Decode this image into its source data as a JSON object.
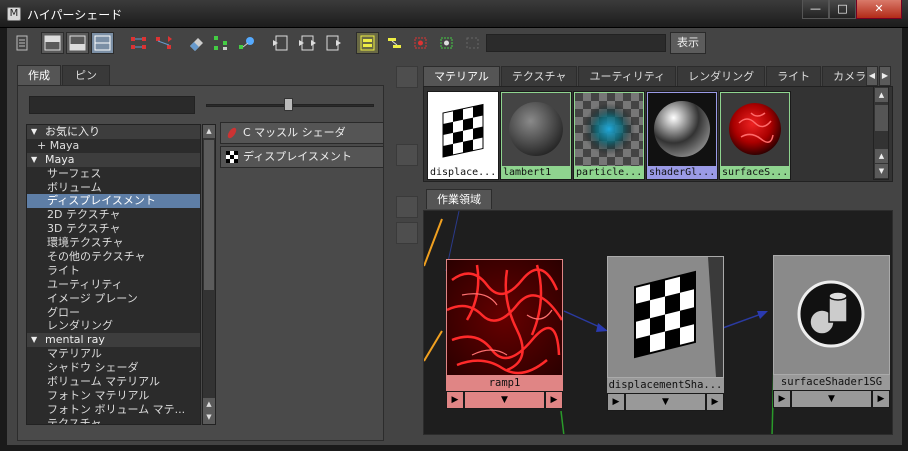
{
  "window": {
    "title": "ハイパーシェード",
    "minimize": "—",
    "maximize": "□",
    "close": "✕"
  },
  "toolbar": {
    "show_label": "表示",
    "search_value": ""
  },
  "left": {
    "tabs": [
      {
        "label": "作成"
      },
      {
        "label": "ピン"
      }
    ],
    "filter_value": "",
    "tree": [
      {
        "label": "お気に入り",
        "kind": "cat"
      },
      {
        "label": "+ Maya",
        "kind": "sub"
      },
      {
        "label": "Maya",
        "kind": "cat"
      },
      {
        "label": "サーフェス",
        "kind": "item"
      },
      {
        "label": "ボリューム",
        "kind": "item"
      },
      {
        "label": "ディスプレイスメント",
        "kind": "sel"
      },
      {
        "label": "2D テクスチャ",
        "kind": "item"
      },
      {
        "label": "3D テクスチャ",
        "kind": "item"
      },
      {
        "label": "環境テクスチャ",
        "kind": "item"
      },
      {
        "label": "その他のテクスチャ",
        "kind": "item"
      },
      {
        "label": "ライト",
        "kind": "item"
      },
      {
        "label": "ユーティリティ",
        "kind": "item"
      },
      {
        "label": "イメージ プレーン",
        "kind": "item"
      },
      {
        "label": "グロー",
        "kind": "item"
      },
      {
        "label": "レンダリング",
        "kind": "item"
      },
      {
        "label": "mental ray",
        "kind": "cat"
      },
      {
        "label": "マテリアル",
        "kind": "item"
      },
      {
        "label": "シャドウ シェーダ",
        "kind": "item"
      },
      {
        "label": "ボリューム マテリアル",
        "kind": "item"
      },
      {
        "label": "フォトン マテリアル",
        "kind": "item"
      },
      {
        "label": "フォトン ボリューム マテ...",
        "kind": "item"
      },
      {
        "label": "テクスチャ",
        "kind": "item"
      }
    ],
    "nodes": [
      {
        "label": "C マッスル シェーダ",
        "icon": "muscle-shader-icon"
      },
      {
        "label": "ディスプレイスメント",
        "icon": "displacement-icon"
      }
    ]
  },
  "right": {
    "tabs": [
      {
        "label": "マテリアル",
        "active": true
      },
      {
        "label": "テクスチャ",
        "active": false
      },
      {
        "label": "ユーティリティ",
        "active": false
      },
      {
        "label": "レンダリング",
        "active": false
      },
      {
        "label": "ライト",
        "active": false
      },
      {
        "label": "カメラ",
        "active": false
      }
    ],
    "swatches": [
      {
        "label": "displace...",
        "color": "#ffffff",
        "icon": "checker-flag-icon"
      },
      {
        "label": "lambert1",
        "color": "#8fd48f",
        "icon": "gray-sphere-icon"
      },
      {
        "label": "particle...",
        "color": "#8fd48f",
        "icon": "particle-cloud-icon"
      },
      {
        "label": "shaderGl...",
        "color": "#9a9ae6",
        "icon": "glossy-sphere-icon"
      },
      {
        "label": "surfaceS...",
        "color": "#8fd48f",
        "icon": "red-sphere-icon"
      }
    ],
    "work_tab": "作業領域",
    "graph_nodes": [
      {
        "label": "ramp1",
        "color": "#e08585",
        "icon": "red-marble-icon"
      },
      {
        "label": "displacementSha...",
        "color": "#999999",
        "icon": "checker-flag-icon"
      },
      {
        "label": "surfaceShader1SG",
        "color": "#999999",
        "icon": "shading-group-icon"
      }
    ]
  },
  "colors": {
    "selection": "#5e7ea6",
    "material_tab": "#8fd48f"
  }
}
